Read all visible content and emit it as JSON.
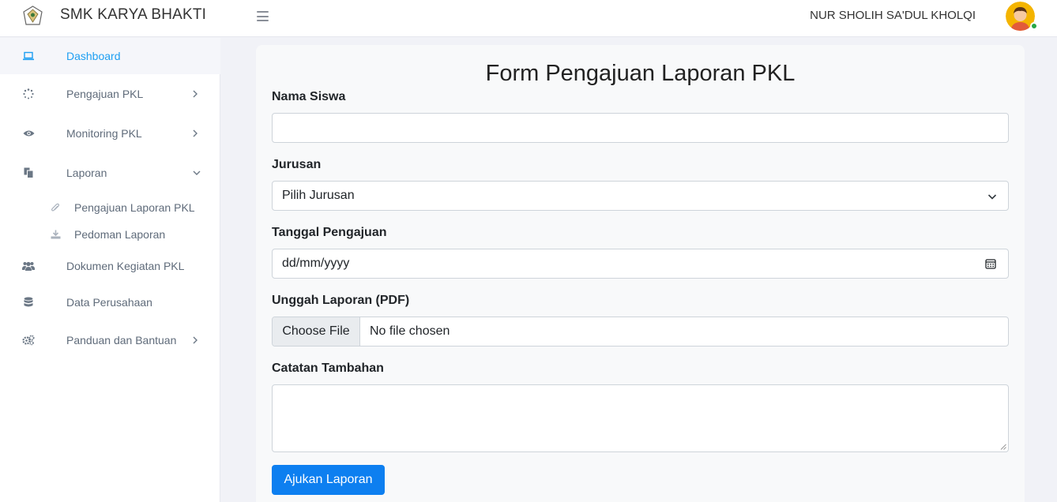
{
  "header": {
    "brand": "SMK KARYA BHAKTI",
    "username": "NUR SHOLIH SA'DUL KHOLQI"
  },
  "sidebar": {
    "items": [
      {
        "label": "Dashboard",
        "icon": "laptop-icon",
        "active": true
      },
      {
        "label": "Pengajuan PKL",
        "icon": "spinner-icon",
        "expandable": true
      },
      {
        "label": "Monitoring PKL",
        "icon": "eye-icon",
        "expandable": true
      },
      {
        "label": "Laporan",
        "icon": "files-icon",
        "expanded": true
      },
      {
        "label": "Dokumen Kegiatan PKL",
        "icon": "users-icon"
      },
      {
        "label": "Data Perusahaan",
        "icon": "database-icon"
      },
      {
        "label": "Panduan dan Bantuan",
        "icon": "gears-icon",
        "expandable": true
      }
    ],
    "subitems": [
      {
        "label": "Pengajuan Laporan PKL",
        "icon": "paperclip-icon"
      },
      {
        "label": "Pedoman Laporan",
        "icon": "download-icon"
      }
    ]
  },
  "form": {
    "title": "Form Pengajuan Laporan PKL",
    "nama_label": "Nama Siswa",
    "nama_value": "",
    "jurusan_label": "Jurusan",
    "jurusan_selected": "Pilih Jurusan",
    "tanggal_label": "Tanggal Pengajuan",
    "tanggal_placeholder": "dd/mm/yyyy",
    "unggah_label": "Unggah Laporan (PDF)",
    "file_button": "Choose File",
    "file_status": "No file chosen",
    "catatan_label": "Catatan Tambahan",
    "catatan_value": "",
    "submit_label": "Ajukan Laporan"
  },
  "colors": {
    "accent": "#1e9ff2",
    "primary_button": "#0d7ff0",
    "status_online": "#28a745"
  }
}
